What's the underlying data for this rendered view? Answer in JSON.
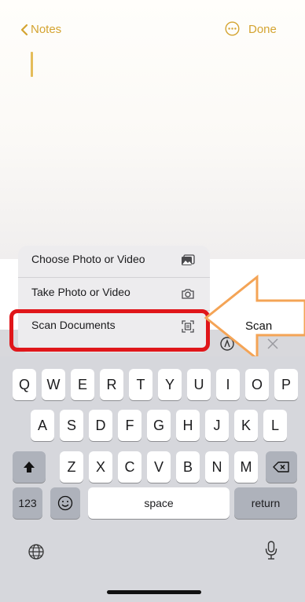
{
  "nav": {
    "back_label": "Notes",
    "done_label": "Done"
  },
  "popup": {
    "items": [
      {
        "label": "Choose Photo or Video",
        "icon": "photo-library-icon"
      },
      {
        "label": "Take Photo or Video",
        "icon": "camera-icon"
      },
      {
        "label": "Scan Documents",
        "icon": "scan-document-icon"
      }
    ]
  },
  "callout": {
    "text": "Scan"
  },
  "toolbar": {
    "text_format_label": "Aa"
  },
  "keyboard": {
    "row1": [
      "Q",
      "W",
      "E",
      "R",
      "T",
      "Y",
      "U",
      "I",
      "O",
      "P"
    ],
    "row2": [
      "A",
      "S",
      "D",
      "F",
      "G",
      "H",
      "J",
      "K",
      "L"
    ],
    "row3": [
      "Z",
      "X",
      "C",
      "V",
      "B",
      "N",
      "M"
    ],
    "numbers_label": "123",
    "space_label": "space",
    "return_label": "return"
  },
  "colors": {
    "accent": "#d4a431",
    "highlight": "#e0161a",
    "arrow": "#f4a456"
  }
}
